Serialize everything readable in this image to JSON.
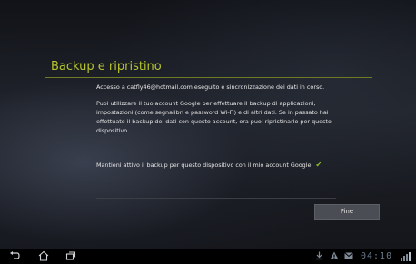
{
  "dialog": {
    "title": "Backup e ripristino",
    "sync_status": "Accesso a catfly46@hotmail.com eseguito e sincronizzazione dei dati in corso.",
    "description": "Puoi utilizzare il tuo account Google per effettuare il backup di applicazioni, impostazioni (come segnalibri e password Wi-Fi) e di altri dati. Se in passato hai effettuato il backup dei dati con questo account, ora puoi ripristinarlo per questo dispositivo.",
    "keep_backup_label": "Mantieni attivo il backup per questo dispositivo con il mio account Google",
    "keep_backup_checked": true,
    "done_label": "Fine"
  },
  "navbar": {
    "back_icon": "back-icon",
    "home_icon": "home-icon",
    "recent_icon": "recent-apps-icon"
  },
  "status": {
    "clock": "04:10",
    "icons": [
      "download-icon",
      "warning-icon",
      "notification-icon",
      "signal-icon"
    ]
  },
  "colors": {
    "accent": "#b6c42d",
    "check": "#8fbf2a",
    "button_bg": "#4a4d53"
  }
}
